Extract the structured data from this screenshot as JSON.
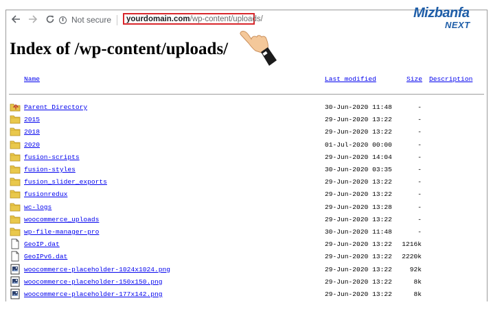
{
  "browser": {
    "secure_label": "Not secure",
    "address_domain": "yourdomain.com",
    "address_path": "/wp-content/uploads/",
    "back_icon": "back-arrow-icon",
    "forward_icon": "forward-arrow-icon",
    "reload_icon": "reload-icon",
    "info_icon": "info-icon"
  },
  "logo": {
    "main": "Mizbanfa",
    "sub": "NEXT",
    "color": "#1f5ea8"
  },
  "page": {
    "title": "Index of /wp-content/uploads/",
    "columns": {
      "name": "Name",
      "last_modified": "Last modified",
      "size": "Size",
      "description": "Description"
    }
  },
  "entries": [
    {
      "icon": "parent-directory-icon",
      "name": "Parent Directory",
      "modified": "30-Jun-2020 11:48",
      "size": "-"
    },
    {
      "icon": "folder-icon",
      "name": "2015",
      "modified": "29-Jun-2020 13:22",
      "size": "-"
    },
    {
      "icon": "folder-icon",
      "name": "2018",
      "modified": "29-Jun-2020 13:22",
      "size": "-"
    },
    {
      "icon": "folder-icon",
      "name": "2020",
      "modified": "01-Jul-2020 00:00",
      "size": "-"
    },
    {
      "icon": "folder-icon",
      "name": "fusion-scripts",
      "modified": "29-Jun-2020 14:04",
      "size": "-"
    },
    {
      "icon": "folder-icon",
      "name": "fusion-styles",
      "modified": "30-Jun-2020 03:35",
      "size": "-"
    },
    {
      "icon": "folder-icon",
      "name": "fusion_slider_exports",
      "modified": "29-Jun-2020 13:22",
      "size": "-"
    },
    {
      "icon": "folder-icon",
      "name": "fusionredux",
      "modified": "29-Jun-2020 13:22",
      "size": "-"
    },
    {
      "icon": "folder-icon",
      "name": "wc-logs",
      "modified": "29-Jun-2020 13:28",
      "size": "-"
    },
    {
      "icon": "folder-icon",
      "name": "woocommerce_uploads",
      "modified": "29-Jun-2020 13:22",
      "size": "-"
    },
    {
      "icon": "folder-icon",
      "name": "wp-file-manager-pro",
      "modified": "30-Jun-2020 11:48",
      "size": "-"
    },
    {
      "icon": "file-icon",
      "name": "GeoIP.dat",
      "modified": "29-Jun-2020 13:22",
      "size": "1216k"
    },
    {
      "icon": "file-icon",
      "name": "GeoIPv6.dat",
      "modified": "29-Jun-2020 13:22",
      "size": "2220k"
    },
    {
      "icon": "image-file-icon",
      "name": "woocommerce-placeholder-1024x1024.png",
      "modified": "29-Jun-2020 13:22",
      "size": "92k"
    },
    {
      "icon": "image-file-icon",
      "name": "woocommerce-placeholder-150x150.png",
      "modified": "29-Jun-2020 13:22",
      "size": "8k"
    },
    {
      "icon": "image-file-icon",
      "name": "woocommerce-placeholder-177x142.png",
      "modified": "29-Jun-2020 13:22",
      "size": "8k"
    }
  ]
}
